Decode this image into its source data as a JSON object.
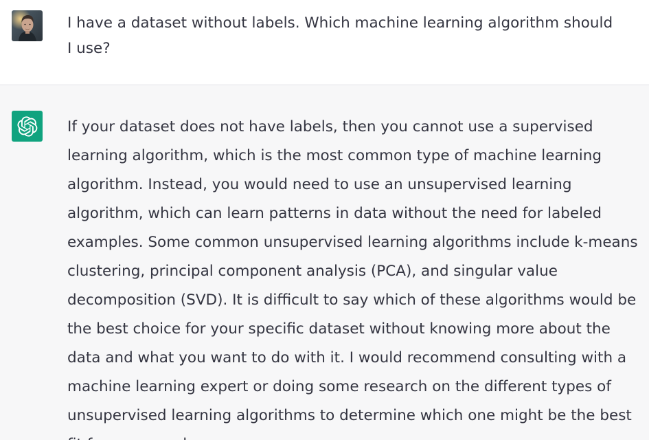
{
  "conversation": {
    "user_message": {
      "avatar": "user-portrait-avatar",
      "text": "I have a dataset without labels. Which machine learning algorithm should I use?"
    },
    "assistant_message": {
      "avatar": "openai-logo-icon",
      "text": "If your dataset does not have labels, then you cannot use a supervised learning algorithm, which is the most common type of machine learning algorithm. Instead, you would need to use an unsupervised learning algorithm, which can learn patterns in data without the need for labeled examples. Some common unsupervised learning algorithms include k-means clustering, principal component analysis (PCA), and singular value decomposition (SVD). It is difficult to say which of these algorithms would be the best choice for your specific dataset without knowing more about the data and what you want to do with it. I would recommend consulting with a machine learning expert or doing some research on the different types of unsupervised learning algorithms to determine which one might be the best fit for your needs."
    }
  },
  "colors": {
    "user_background": "#ffffff",
    "assistant_background": "#f7f7f8",
    "assistant_avatar": "#10a37f",
    "text": "#343541",
    "divider": "#e2e2e6"
  }
}
